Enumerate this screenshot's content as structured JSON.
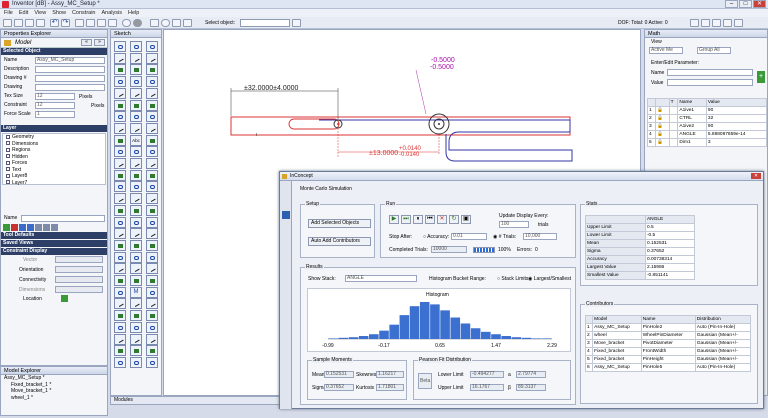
{
  "window": {
    "title": "Inventor [dB] - Assy_MC_Setup *",
    "min": "–",
    "max": "□",
    "close": "✕"
  },
  "menu": [
    "File",
    "Edit",
    "View",
    "Show",
    "Constrain",
    "Analysis",
    "Help"
  ],
  "toolbar": {
    "select_label": "Select object:",
    "status": "DOF: Total: 0  Active: 0"
  },
  "properties": {
    "title": "Properties Explorer",
    "panel_label": "Model",
    "selected_object": "Selected Object",
    "fields": [
      {
        "label": "Name",
        "value": "Assy_MC_Setup"
      },
      {
        "label": "Description",
        "value": ""
      },
      {
        "label": "Drawing #",
        "value": ""
      },
      {
        "label": "Drawing",
        "value": ""
      },
      {
        "label": "Tex Size",
        "value": "12",
        "unit": "Pixels"
      },
      {
        "label": "Constraint",
        "value": "12",
        "unit": "Pixels"
      },
      {
        "label": "Force Scale",
        "value": "1"
      }
    ],
    "layer_header": "Layer",
    "layers": [
      "Geometry",
      "Dimensions",
      "Regions",
      "Hidden",
      "Forces",
      "Text",
      "Layer8",
      "Layer7"
    ],
    "name_label": "Name",
    "sections": [
      "Tool Defaults",
      "Saved Views",
      "Constraint Display"
    ],
    "cd_rows": [
      "Vector",
      "Orientation",
      "Connectivity",
      "Dimensions",
      "Location"
    ]
  },
  "sketch": {
    "title": "Sketch",
    "abc_label": "Abc",
    "text_label": "M"
  },
  "dims": {
    "d1": "±32.0000±4.0000",
    "d2": "-0.5000",
    "d3": "-0.5000",
    "d4": "±13.0000",
    "d5": "+0.0140",
    "d6": "-0.0140"
  },
  "modules_label": "Modules",
  "math": {
    "title": "Math",
    "view": "View",
    "active_label": "Active Me",
    "group_label": "Group All",
    "enter_edit": "Enter/Edit Parameter:",
    "name": "Name",
    "value": "Value",
    "columns": [
      "",
      "",
      "T",
      "Name",
      "Value"
    ],
    "rows": [
      [
        "1",
        "",
        "",
        "A1ive1",
        "90"
      ],
      [
        "2",
        "",
        "",
        "CTRL",
        "32"
      ],
      [
        "3",
        "",
        "",
        "A1ive2",
        "90"
      ],
      [
        "4",
        "",
        "",
        "ANGLE",
        "5.888087859e-14"
      ],
      [
        "5",
        "",
        "",
        "Dim1",
        "3"
      ]
    ]
  },
  "model_explorer": {
    "title": "Model Explorer",
    "items": [
      "Assy_MC_Setup *",
      "Fixed_bracket_1 *",
      "Move_bracket_1 *",
      "wheel_1 *"
    ]
  },
  "mc": {
    "title": "InConcept",
    "heading": "Monte Carlo Simulation",
    "setup": "Setup",
    "add_sel": "Add Selected Objects",
    "auto_add": "Auto Add Contributors",
    "run": "Run",
    "update_label": "Update Display Every:",
    "update_val": "100",
    "trials_word": "trials",
    "stop_after": "Stop After:",
    "accuracy": "Accuracy:",
    "accuracy_val": "0.01",
    "trials_label": "# Trials:",
    "trials_val": "10,000",
    "completed_label": "Completed Trials:",
    "completed_val": "10000",
    "pct": "100%",
    "errors_label": "Errors:",
    "errors_val": "0",
    "stats": {
      "title": "Stats",
      "header": "ANGLE",
      "rows": [
        [
          "Upper Limit",
          "0.5"
        ],
        [
          "Lower Limit",
          "-0.5"
        ],
        [
          "Mean",
          "0.152531"
        ],
        [
          "Sigma",
          "0.37652"
        ],
        [
          "Accuracy",
          "0.00738314"
        ],
        [
          "Largest Value",
          "2.15986"
        ],
        [
          "Smallest Value",
          "-0.851141"
        ]
      ]
    },
    "results": {
      "title": "Results",
      "show_stack": "Show Stack:",
      "stack_val": "ANGLE",
      "bucket_label": "Histogram Bucket Range:",
      "stack_limits": "Stack Limits",
      "largest_smallest": "Largest/Smallest",
      "hist_title": "Histogram"
    },
    "sample": {
      "title": "Sample Moments",
      "mean_label": "Mean",
      "mean": "0.152531",
      "skew_label": "Skewness",
      "skew": "1.16217",
      "sigma_label": "Sigma",
      "sigma": "0.37652",
      "kurt_label": "Kurtosis",
      "kurt": "1.71801"
    },
    "pearson": {
      "title": "Pearson Fit Distribution",
      "beta": "Beta",
      "lower_label": "Lower Limit",
      "lower": "-0.494277",
      "a_label": "a",
      "a": "2.79774",
      "upper_label": "Upper Limit",
      "upper": "16.1767",
      "b_label": "β",
      "b": "89.3137"
    },
    "contrib": {
      "title": "Contributors",
      "columns": [
        "",
        "Model",
        "Name",
        "Distribution"
      ],
      "rows": [
        [
          "1",
          "Assy_MC_Setup",
          "PinHole2",
          "Auto (Pin-In-Hole)"
        ],
        [
          "2",
          "wheel",
          "WheelPinDiameter",
          "Gaussian (Mean+/-"
        ],
        [
          "3",
          "Move_bracket",
          "PivotDiameter",
          "Gaussian (Mean+/-"
        ],
        [
          "4",
          "Fixed_bracket",
          "FrontWidth",
          "Gaussian (Mean+/-"
        ],
        [
          "5",
          "Fixed_bracket",
          "PinHeight",
          "Gaussian (Mean+/-"
        ],
        [
          "6",
          "Assy_MC_Setup",
          "PinHole5",
          "Auto (Pin-In-Hole)"
        ]
      ]
    }
  },
  "chart_data": {
    "type": "bar",
    "title": "Histogram",
    "x_ticks": [
      "-0.99",
      "-0.17",
      "0.65",
      "1.47",
      "2.29"
    ],
    "values": [
      1,
      2,
      3,
      5,
      8,
      14,
      24,
      40,
      55,
      62,
      58,
      48,
      36,
      26,
      18,
      12,
      8,
      5,
      3,
      2,
      1,
      1
    ]
  }
}
